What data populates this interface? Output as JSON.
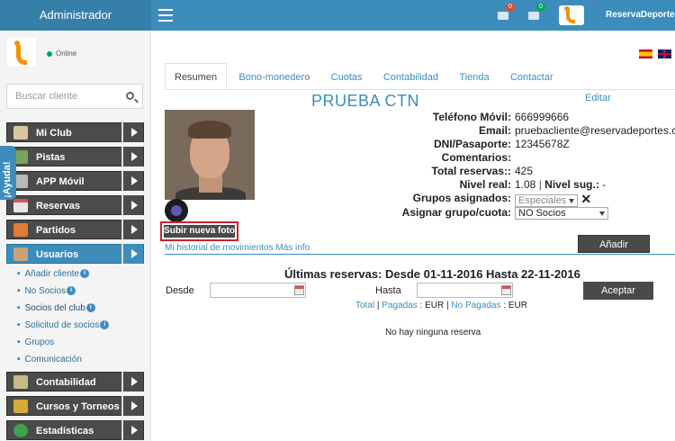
{
  "header": {
    "brand": "Administrador",
    "mail_count": "0",
    "notif_count": "0",
    "user_name": "ReservaDeportes",
    "colors": {
      "bar": "#3c8dbc",
      "mail_badge": "#dd4b39",
      "notif_badge": "#00a65a"
    }
  },
  "sidebar": {
    "status": "Online",
    "search_placeholder": "Buscar cliente",
    "help_label": "¡Ayuda!",
    "items": [
      {
        "label": "Mi Club",
        "icon": "club-icon"
      },
      {
        "label": "Pistas",
        "icon": "court-icon"
      },
      {
        "label": "APP Móvil",
        "icon": "mobile-icon"
      },
      {
        "label": "Reservas",
        "icon": "calendar-icon"
      },
      {
        "label": "Partidos",
        "icon": "match-icon"
      },
      {
        "label": "Usuarios",
        "icon": "users-icon"
      }
    ],
    "submenu": [
      {
        "label": "Añadir cliente"
      },
      {
        "label": "No Socios"
      },
      {
        "label": "Socios del club"
      },
      {
        "label": "Solicitud de socios"
      },
      {
        "label": "Grupos"
      },
      {
        "label": "Comunicación"
      }
    ],
    "items_after": [
      {
        "label": "Contabilidad",
        "icon": "money-icon"
      },
      {
        "label": "Cursos y Torneos",
        "icon": "trophy-icon"
      },
      {
        "label": "Estadísticas",
        "icon": "chart-icon"
      }
    ]
  },
  "tabs": [
    "Resumen",
    "Bono-monedero",
    "Cuotas",
    "Contabilidad",
    "Tienda",
    "Contactar"
  ],
  "profile": {
    "name": "PRUEBA CTN",
    "edit_label": "Editar",
    "upload_label": "Subir nueva foto",
    "history_link": "Mi historial de movimientos Más info",
    "fields": {
      "phone_label": "Teléfono Móvil:",
      "phone_value": "666999666",
      "email_label": "Email:",
      "email_value": "pruebacliente@reservadeportes.com",
      "dni_label": "DNI/Pasaporte:",
      "dni_value": "12345678Z",
      "comments_label": "Comentarios:",
      "total_label": "Total reservas::",
      "total_value": "425",
      "level_label": "Nivel real:",
      "level_value": "1.08",
      "level_sug_label": "Nivel sug.:",
      "level_sug_value": "-",
      "groups_label": "Grupos asignados:",
      "groups_value": "Especiales",
      "assign_label": "Asignar grupo/cuota:",
      "assign_value": "NO Socios"
    },
    "add_label": "Añadir"
  },
  "reservations": {
    "title": "Últimas reservas: Desde 01-11-2016 Hasta 22-11-2016",
    "from_label": "Desde",
    "to_label": "Hasta",
    "accept_label": "Aceptar",
    "total_link": "Total",
    "paid_link": "Pagadas",
    "paid_value": "EUR",
    "unpaid_link": "No Pagadas",
    "unpaid_value": "EUR",
    "empty": "No hay ninguna reserva"
  }
}
